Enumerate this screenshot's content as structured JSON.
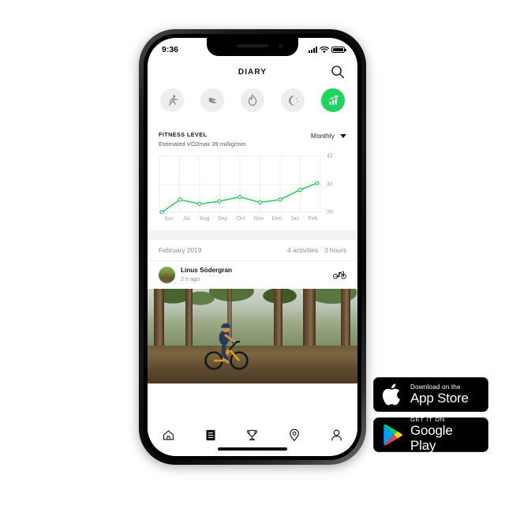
{
  "status_bar": {
    "time": "9:36",
    "icons": [
      "signal-bars",
      "wifi",
      "battery"
    ]
  },
  "header": {
    "title": "DIARY",
    "search_icon": "search-icon"
  },
  "activity_filters": [
    {
      "name": "running",
      "icon": "running-icon",
      "active": false
    },
    {
      "name": "steps",
      "icon": "shoe-icon",
      "active": false
    },
    {
      "name": "calories",
      "icon": "flame-icon",
      "active": false
    },
    {
      "name": "sleep",
      "icon": "moon-icon",
      "active": false
    },
    {
      "name": "fitness",
      "icon": "bar-chart-icon",
      "active": true
    }
  ],
  "fitness_card": {
    "title": "FITNESS LEVEL",
    "subtitle": "Estimated VO2max 39 ml/kg/min",
    "period": "Monthly",
    "chevron_icon": "chevron-down-icon"
  },
  "chart_data": {
    "type": "line",
    "title": "FITNESS LEVEL",
    "subtitle": "Estimated VO2max 39 ml/kg/min",
    "xlabel": "",
    "ylabel": "",
    "categories": [
      "Jun",
      "Jul",
      "Aug",
      "Sep",
      "Oct",
      "Nov",
      "Dec",
      "Jan",
      "Feb"
    ],
    "values": [
      38.0,
      38.9,
      38.6,
      38.8,
      39.1,
      38.7,
      38.9,
      39.6,
      40.1
    ],
    "ylim": [
      38,
      42
    ],
    "yticks": [
      38,
      40,
      42
    ],
    "grid": true,
    "legend": "none",
    "line_color": "#2ecc5e",
    "marker": "open-circle"
  },
  "month_summary": {
    "month": "February 2019",
    "activities": "4 activities",
    "duration": "3 hours"
  },
  "activity_entry": {
    "name": "Linus Södergran",
    "time": "2 h ago",
    "type_icon": "bicycle-icon",
    "avatar": "avatar"
  },
  "bottom_nav": [
    {
      "name": "home",
      "icon": "home-icon",
      "active": false
    },
    {
      "name": "diary",
      "icon": "diary-icon",
      "active": true
    },
    {
      "name": "challenges",
      "icon": "trophy-icon",
      "active": false
    },
    {
      "name": "explore",
      "icon": "location-pin-icon",
      "active": false
    },
    {
      "name": "profile",
      "icon": "person-icon",
      "active": false
    }
  ],
  "store_badges": {
    "app_store": {
      "small": "Download on the",
      "big": "App Store",
      "icon": "apple-icon"
    },
    "google_play": {
      "small": "GET IT ON",
      "big": "Google Play",
      "icon": "google-play-icon"
    }
  },
  "colors": {
    "accent_green": "#1fd35e",
    "chart_line": "#2ecc5e",
    "background": "#ffffff",
    "separator": "#f2f2f3"
  }
}
